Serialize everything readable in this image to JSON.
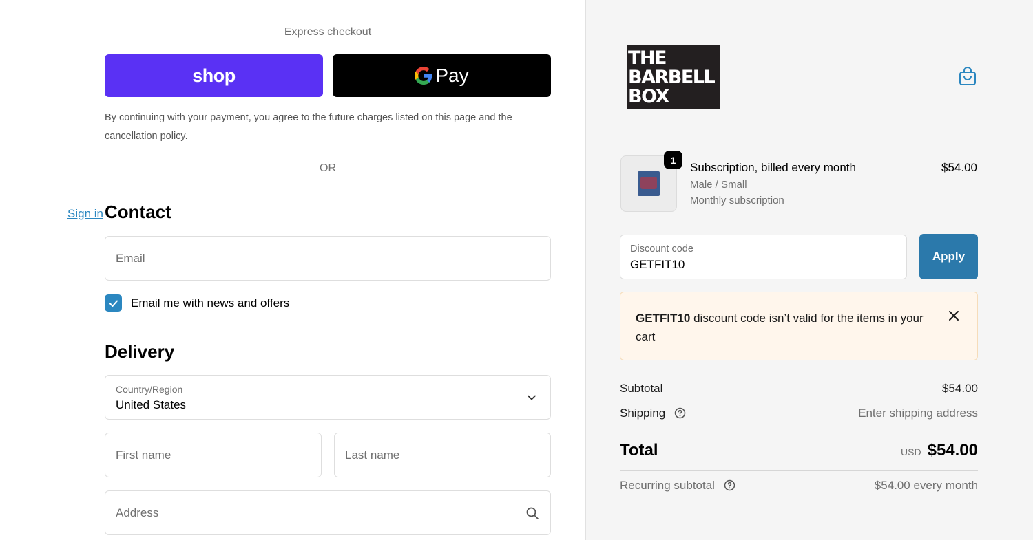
{
  "express": {
    "title": "Express checkout",
    "shop_label": "shop",
    "gpay_label": "Pay",
    "consent": "By continuing with your payment, you agree to the future charges listed on this page and the cancellation policy.",
    "or": "OR"
  },
  "contact": {
    "heading": "Contact",
    "sign_in": "Sign in",
    "email_placeholder": "Email",
    "newsletter_label": "Email me with news and offers",
    "newsletter_checked": true
  },
  "delivery": {
    "heading": "Delivery",
    "country_label": "Country/Region",
    "country_value": "United States",
    "first_name_placeholder": "First name",
    "last_name_placeholder": "Last name",
    "address_placeholder": "Address"
  },
  "summary": {
    "brand_logo": [
      "THE",
      "BARBELL",
      "BOX"
    ],
    "cart_icon": "shopping-bag-icon",
    "item": {
      "quantity": "1",
      "title": "Subscription, billed every month",
      "variant": "Male / Small",
      "plan": "Monthly subscription",
      "price": "$54.00"
    },
    "discount": {
      "label": "Discount code",
      "value": "GETFIT10",
      "apply_label": "Apply"
    },
    "alert": {
      "code": "GETFIT10",
      "message": " discount code isn’t valid for the items in your cart"
    },
    "subtotal_label": "Subtotal",
    "subtotal_value": "$54.00",
    "shipping_label": "Shipping",
    "shipping_value": "Enter shipping address",
    "total_label": "Total",
    "currency": "USD",
    "total_value": "$54.00",
    "recurring_label": "Recurring subtotal",
    "recurring_value": "$54.00 every month"
  },
  "colors": {
    "shop_purple": "#5a31f4",
    "accent_blue": "#2b87c0",
    "apply_blue": "#2b79ab",
    "alert_bg": "#fff6ec",
    "summary_bg": "#f5f5f5"
  }
}
